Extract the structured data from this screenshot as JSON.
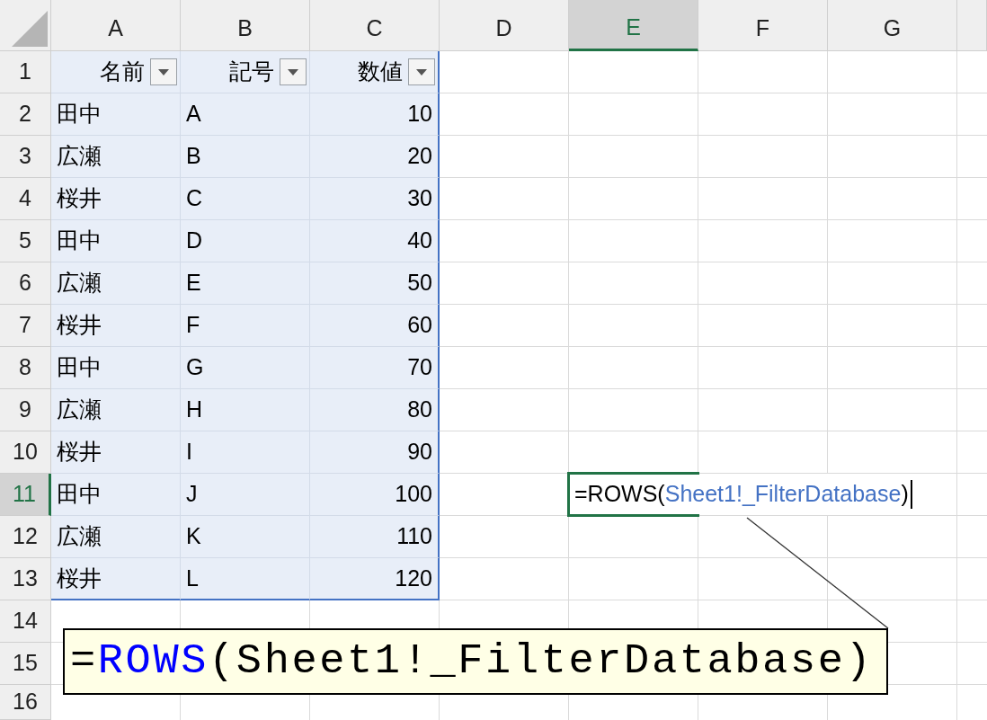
{
  "columns": [
    {
      "label": "A",
      "selected": false
    },
    {
      "label": "B",
      "selected": false
    },
    {
      "label": "C",
      "selected": false
    },
    {
      "label": "D",
      "selected": false
    },
    {
      "label": "E",
      "selected": true
    },
    {
      "label": "F",
      "selected": false
    },
    {
      "label": "G",
      "selected": false
    }
  ],
  "rows": [
    {
      "label": "1",
      "selected": false
    },
    {
      "label": "2",
      "selected": false
    },
    {
      "label": "3",
      "selected": false
    },
    {
      "label": "4",
      "selected": false
    },
    {
      "label": "5",
      "selected": false
    },
    {
      "label": "6",
      "selected": false
    },
    {
      "label": "7",
      "selected": false
    },
    {
      "label": "8",
      "selected": false
    },
    {
      "label": "9",
      "selected": false
    },
    {
      "label": "10",
      "selected": false
    },
    {
      "label": "11",
      "selected": true
    },
    {
      "label": "12",
      "selected": false
    },
    {
      "label": "13",
      "selected": false
    },
    {
      "label": "14",
      "selected": false
    },
    {
      "label": "15",
      "selected": false
    },
    {
      "label": "16",
      "selected": false
    }
  ],
  "table": {
    "headers": [
      "名前",
      "記号",
      "数値"
    ],
    "rows": [
      [
        "田中",
        "A",
        "10"
      ],
      [
        "広瀬",
        "B",
        "20"
      ],
      [
        "桜井",
        "C",
        "30"
      ],
      [
        "田中",
        "D",
        "40"
      ],
      [
        "広瀬",
        "E",
        "50"
      ],
      [
        "桜井",
        "F",
        "60"
      ],
      [
        "田中",
        "G",
        "70"
      ],
      [
        "広瀬",
        "H",
        "80"
      ],
      [
        "桜井",
        "I",
        "90"
      ],
      [
        "田中",
        "J",
        "100"
      ],
      [
        "広瀬",
        "K",
        "110"
      ],
      [
        "桜井",
        "L",
        "120"
      ]
    ]
  },
  "active_cell": {
    "parts": [
      {
        "kind": "plain",
        "text": "=ROWS("
      },
      {
        "kind": "reference",
        "text": "Sheet1!_FilterDatabase"
      },
      {
        "kind": "plain",
        "text": ")"
      }
    ]
  },
  "callout": {
    "parts": [
      {
        "kind": "plain",
        "text": "="
      },
      {
        "kind": "function",
        "text": "ROWS"
      },
      {
        "kind": "plain",
        "text": "(Sheet1!_FilterDatabase)"
      }
    ]
  }
}
